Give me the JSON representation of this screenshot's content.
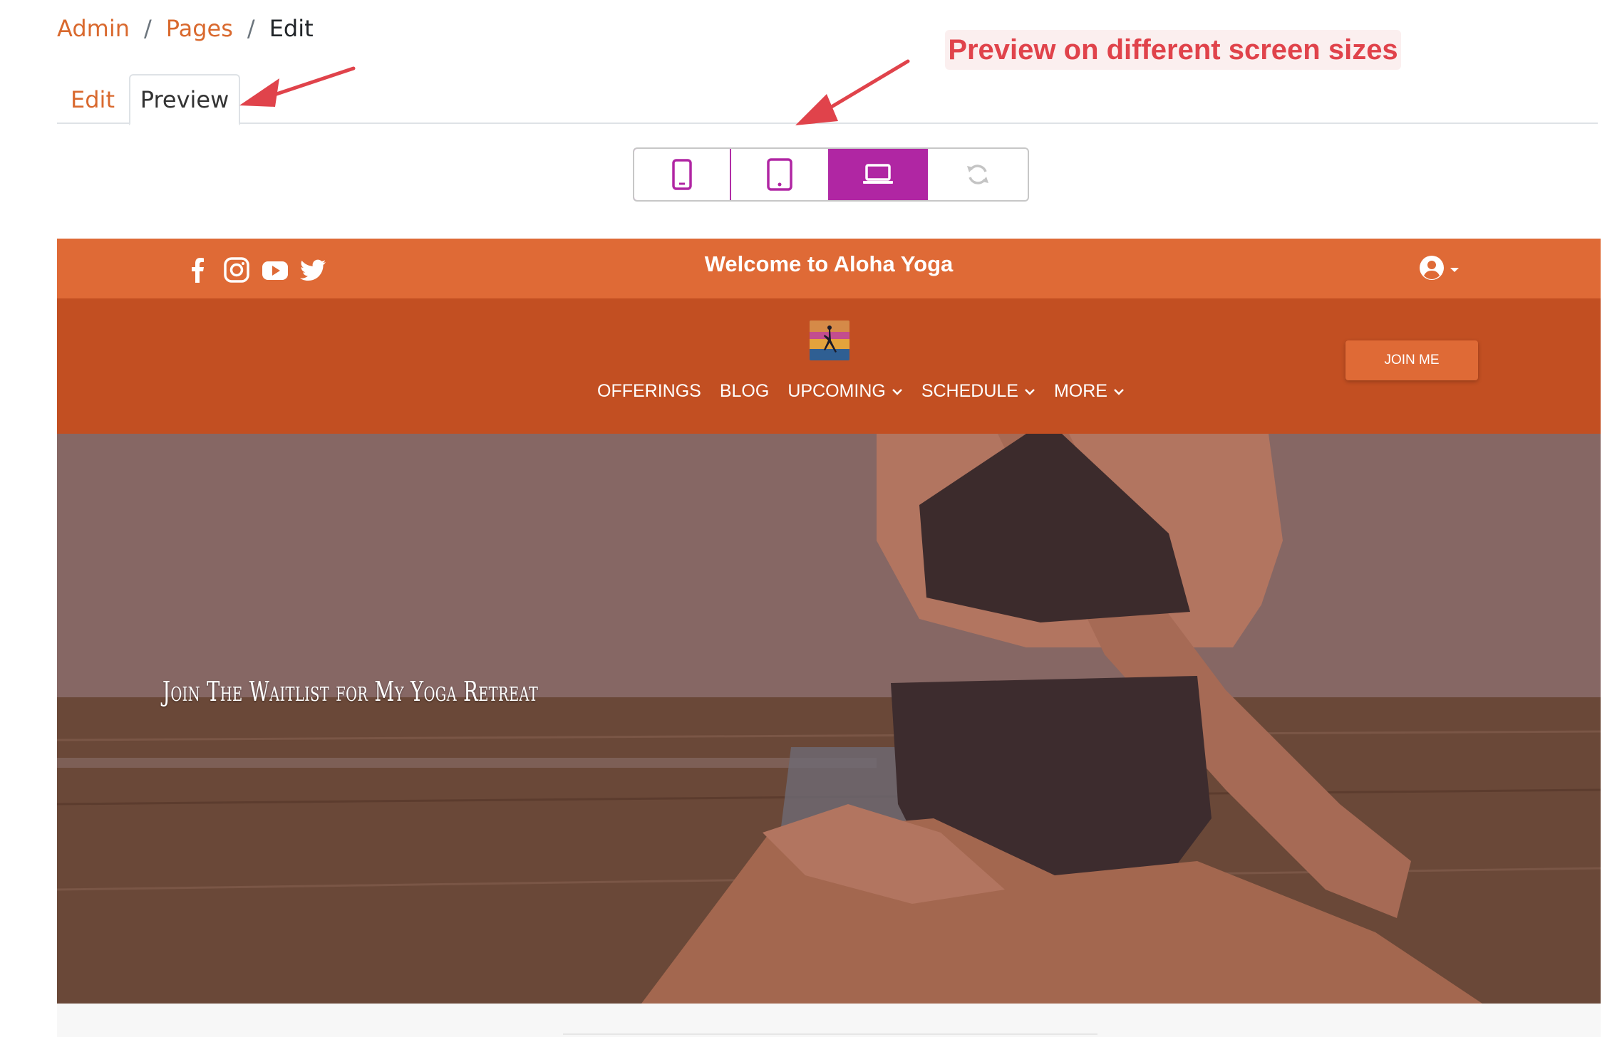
{
  "breadcrumb": {
    "items": [
      "Admin",
      "Pages"
    ],
    "current": "Edit",
    "separator": "/"
  },
  "tabs": [
    {
      "label": "Edit"
    },
    {
      "label": "Preview",
      "active": true
    }
  ],
  "annotation": {
    "text": "Preview on different screen sizes",
    "color": "#e0434b"
  },
  "device_toggle": {
    "buttons": [
      {
        "icon": "phone-icon"
      },
      {
        "icon": "tablet-icon"
      },
      {
        "icon": "laptop-icon",
        "active": true
      },
      {
        "icon": "refresh-icon"
      }
    ],
    "accent": "#b026a3"
  },
  "site": {
    "top_bar": {
      "title": "Welcome to Aloha Yoga",
      "social_icons": [
        "facebook-icon",
        "instagram-icon",
        "youtube-icon",
        "twitter-icon"
      ],
      "color": "#df6a36"
    },
    "navbar": {
      "join_button": "JOIN ME",
      "menu": [
        {
          "label": "OFFERINGS",
          "dropdown": false
        },
        {
          "label": "BLOG",
          "dropdown": false
        },
        {
          "label": "UPCOMING",
          "dropdown": true
        },
        {
          "label": "SCHEDULE",
          "dropdown": true
        },
        {
          "label": "MORE",
          "dropdown": true
        }
      ],
      "color": "#c24f22"
    },
    "hero": {
      "title": "Join The Waitlist for My Yoga Retreat"
    }
  }
}
